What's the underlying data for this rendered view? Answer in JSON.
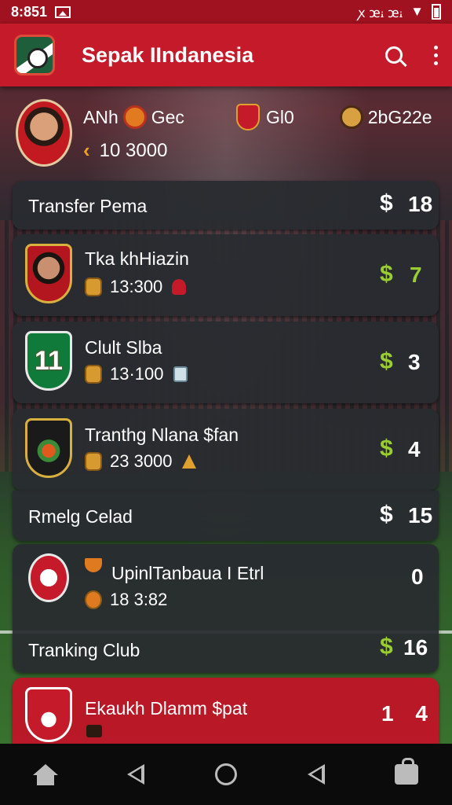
{
  "status_bar": {
    "time": "8:851",
    "signal_text": "ꭗ ꭢꭵ ꭢꭵ"
  },
  "app_bar": {
    "title": "Sepak IIndanesia"
  },
  "profile": {
    "name": "ANh",
    "stat1": "Gec",
    "stat2": "Gl0",
    "stat3": "2bG22e",
    "coins": "10 3000"
  },
  "cards": [
    {
      "title": "Transfer Pema",
      "dollar": "$",
      "count": "18",
      "dollar_color": "#ffffff"
    },
    {
      "title": "Tka khHiazin",
      "sub": "13:300",
      "dollar": "$",
      "count": "7",
      "dollar_color": "#9acd32",
      "count_color": "#9acd32"
    },
    {
      "title": "Clult Slba",
      "sub": "13·100",
      "dollar": "$",
      "count": "3",
      "dollar_color": "#9acd32",
      "crest_text": "11"
    },
    {
      "title": "Tranthg Nlana $fan",
      "sub": "23 3000",
      "dollar": "$",
      "count": "4",
      "dollar_color": "#9acd32"
    },
    {
      "title": "Rmelg Celad",
      "dollar": "$",
      "count": "15",
      "dollar_color": "#ffffff"
    },
    {
      "title": "UpinlTanbaua I Etrl",
      "sub": "18 3:82",
      "count": "0"
    },
    {
      "title": "Tranking Club",
      "dollar": "$",
      "count": "16",
      "dollar_color": "#9acd32"
    },
    {
      "title": "Ekaukh Dlamm $pat",
      "count": "1 4"
    }
  ]
}
